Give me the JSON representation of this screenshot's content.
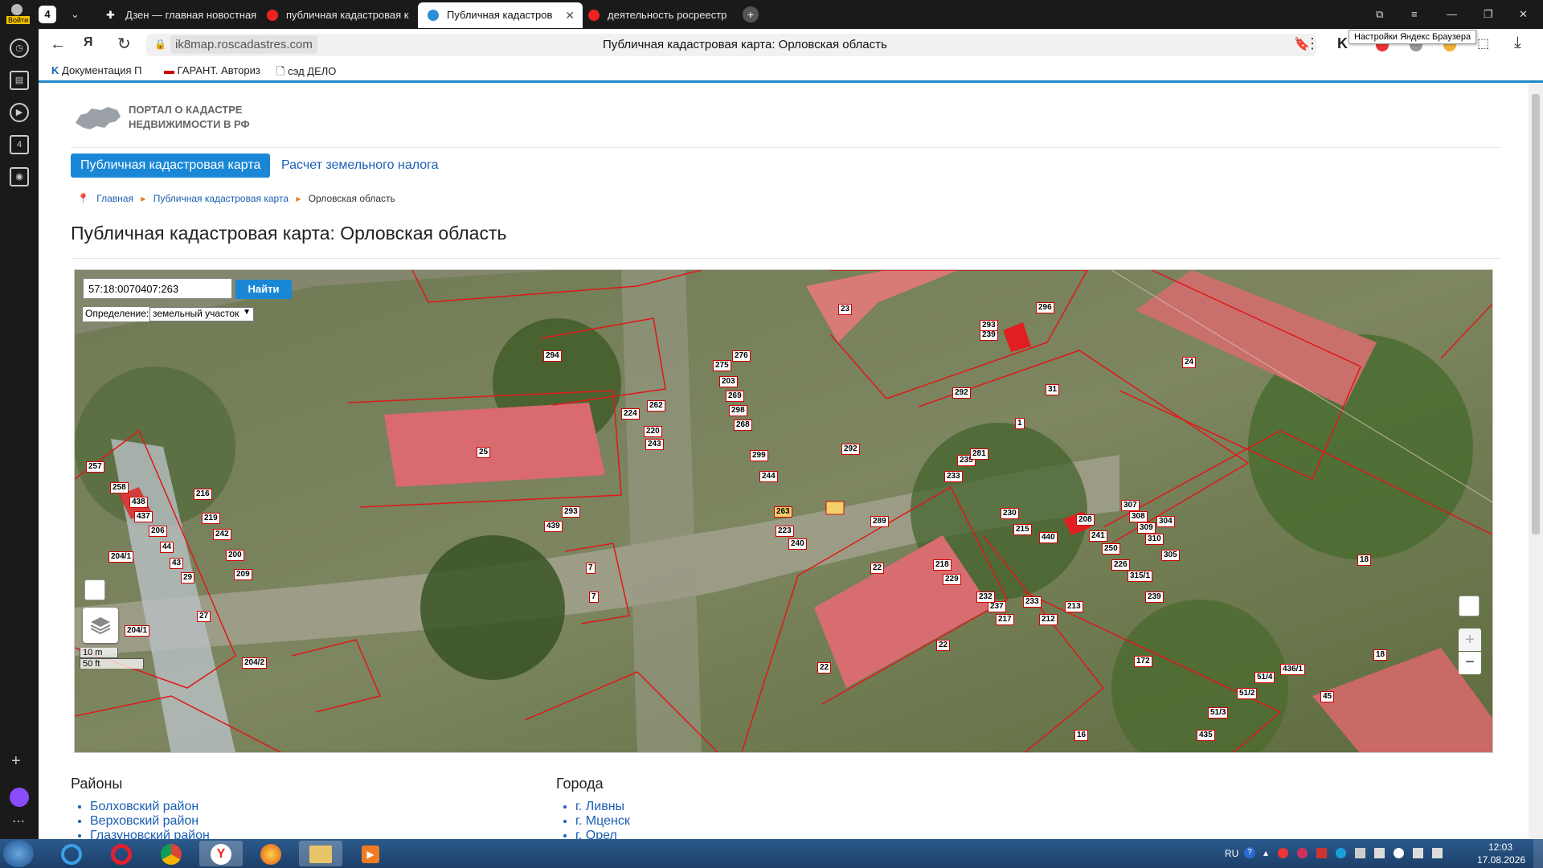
{
  "browser": {
    "tab_count": "4",
    "login_label": "Войти",
    "tabs": [
      {
        "title": "Дзен — главная новостная"
      },
      {
        "title": "публичная кадастровая к"
      },
      {
        "title": "Публичная кадастров"
      },
      {
        "title": "деятельность росреестр"
      }
    ],
    "url": "ik8map.roscadastres.com",
    "page_title": "Публичная кадастровая карта: Орловская область",
    "tooltip": "Настройки Яндекс Браузера",
    "bookmarks": [
      "Документация П",
      "ГАРАНТ. Авториз",
      "сэд ДЕЛО"
    ]
  },
  "site": {
    "logo_line1": "ПОРТАЛ О КАДАСТРЕ",
    "logo_line2": "НЕДВИЖИМОСТИ В РФ",
    "nav_active": "Публичная кадастровая карта",
    "nav_link": "Расчет земельного налога",
    "breadcrumb": [
      "Главная",
      "Публичная кадастровая карта",
      "Орловская область"
    ],
    "heading": "Публичная кадастровая карта: Орловская область"
  },
  "map": {
    "search_value": "57:18:0070407:263",
    "search_button": "Найти",
    "definition_label": "Определение:",
    "definition_value": "земельный участок",
    "scale_m": "10 m",
    "scale_ft": "50 ft",
    "zoom_in": "+",
    "zoom_out": "−",
    "labels": [
      "23",
      "294",
      "25",
      "292",
      "24",
      "31",
      "1",
      "292",
      "262",
      "224",
      "220",
      "243",
      "275",
      "276",
      "203",
      "269",
      "298",
      "268",
      "299",
      "244",
      "263",
      "223",
      "240",
      "289",
      "22",
      "22",
      "22",
      "7",
      "7",
      "439",
      "293",
      "257",
      "258",
      "438",
      "437",
      "216",
      "219",
      "242",
      "206",
      "200",
      "209",
      "44",
      "43",
      "29",
      "27",
      "204/1",
      "204/1",
      "204/2",
      "233",
      "235",
      "281",
      "239",
      "293",
      "296",
      "230",
      "215",
      "440",
      "208",
      "241",
      "250",
      "226",
      "315/1",
      "307",
      "308",
      "309",
      "310",
      "304",
      "305",
      "18",
      "18",
      "45",
      "16",
      "172",
      "51/3",
      "51/2",
      "51/4",
      "435",
      "436/1",
      "218",
      "229",
      "237",
      "217",
      "212",
      "232",
      "213",
      "233",
      "239"
    ]
  },
  "lists": {
    "districts_title": "Районы",
    "districts": [
      "Болховский район",
      "Верховский район",
      "Глазуновский район"
    ],
    "cities_title": "Города",
    "cities": [
      "г. Ливны",
      "г. Мценск",
      "г. Орел"
    ]
  },
  "taskbar": {
    "lang": "RU",
    "time": "12:03",
    "date": "17.08.2026"
  }
}
